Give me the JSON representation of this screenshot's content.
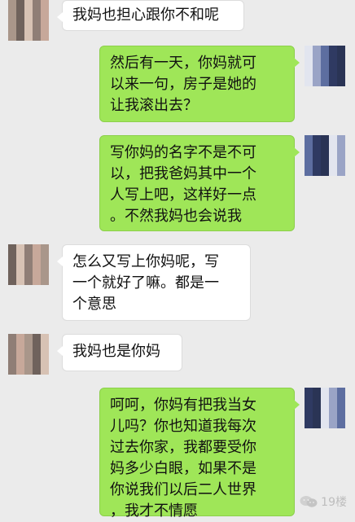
{
  "chat": {
    "messages": [
      {
        "side": "left",
        "lines": [
          "我妈也担心跟你不和呢"
        ]
      },
      {
        "side": "right",
        "lines": [
          "然后有一天，你妈就可",
          "以来一句，房子是她的",
          "让我滚出去？"
        ]
      },
      {
        "side": "right",
        "lines": [
          "写你妈的名字不是不可",
          "以，把我爸妈其中一个",
          "人写上吧，这样好一点",
          "。不然我妈也会说我"
        ]
      },
      {
        "side": "left",
        "lines": [
          "怎么又写上你妈呢，写",
          "一个就好了嘛。都是一",
          "个意思"
        ]
      },
      {
        "side": "left",
        "lines": [
          "我妈也是你妈"
        ]
      },
      {
        "side": "right",
        "lines": [
          "呵呵，你妈有把我当女",
          "儿吗？你也知道我每次",
          "过去你家，我都要受你",
          "妈多少白眼，如果不是",
          "你说我们以后二人世界",
          "，我才不情愿"
        ]
      }
    ]
  },
  "watermark": {
    "text": "19楼",
    "icon": "wechat-icon"
  },
  "colors": {
    "background": "#ebebeb",
    "outgoing_bubble": "#9fe658",
    "incoming_bubble": "#ffffff",
    "left_avatar_palette": [
      "#a9968a",
      "#c7a89a",
      "#8f7e76",
      "#d7c2b4",
      "#6f625c"
    ],
    "right_avatar_palette": [
      "#2f3a62",
      "#5d6ea0",
      "#9aa4c6",
      "#e2e5ef",
      "#2a3455"
    ]
  }
}
